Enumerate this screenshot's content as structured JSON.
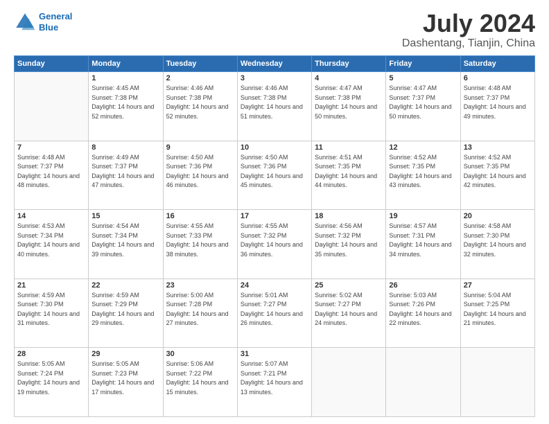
{
  "header": {
    "logo_line1": "General",
    "logo_line2": "Blue",
    "month_title": "July 2024",
    "subtitle": "Dashentang, Tianjin, China"
  },
  "calendar": {
    "days_of_week": [
      "Sunday",
      "Monday",
      "Tuesday",
      "Wednesday",
      "Thursday",
      "Friday",
      "Saturday"
    ],
    "weeks": [
      [
        {
          "day": "",
          "sunrise": "",
          "sunset": "",
          "daylight": ""
        },
        {
          "day": "1",
          "sunrise": "Sunrise: 4:45 AM",
          "sunset": "Sunset: 7:38 PM",
          "daylight": "Daylight: 14 hours and 52 minutes."
        },
        {
          "day": "2",
          "sunrise": "Sunrise: 4:46 AM",
          "sunset": "Sunset: 7:38 PM",
          "daylight": "Daylight: 14 hours and 52 minutes."
        },
        {
          "day": "3",
          "sunrise": "Sunrise: 4:46 AM",
          "sunset": "Sunset: 7:38 PM",
          "daylight": "Daylight: 14 hours and 51 minutes."
        },
        {
          "day": "4",
          "sunrise": "Sunrise: 4:47 AM",
          "sunset": "Sunset: 7:38 PM",
          "daylight": "Daylight: 14 hours and 50 minutes."
        },
        {
          "day": "5",
          "sunrise": "Sunrise: 4:47 AM",
          "sunset": "Sunset: 7:37 PM",
          "daylight": "Daylight: 14 hours and 50 minutes."
        },
        {
          "day": "6",
          "sunrise": "Sunrise: 4:48 AM",
          "sunset": "Sunset: 7:37 PM",
          "daylight": "Daylight: 14 hours and 49 minutes."
        }
      ],
      [
        {
          "day": "7",
          "sunrise": "Sunrise: 4:48 AM",
          "sunset": "Sunset: 7:37 PM",
          "daylight": "Daylight: 14 hours and 48 minutes."
        },
        {
          "day": "8",
          "sunrise": "Sunrise: 4:49 AM",
          "sunset": "Sunset: 7:37 PM",
          "daylight": "Daylight: 14 hours and 47 minutes."
        },
        {
          "day": "9",
          "sunrise": "Sunrise: 4:50 AM",
          "sunset": "Sunset: 7:36 PM",
          "daylight": "Daylight: 14 hours and 46 minutes."
        },
        {
          "day": "10",
          "sunrise": "Sunrise: 4:50 AM",
          "sunset": "Sunset: 7:36 PM",
          "daylight": "Daylight: 14 hours and 45 minutes."
        },
        {
          "day": "11",
          "sunrise": "Sunrise: 4:51 AM",
          "sunset": "Sunset: 7:35 PM",
          "daylight": "Daylight: 14 hours and 44 minutes."
        },
        {
          "day": "12",
          "sunrise": "Sunrise: 4:52 AM",
          "sunset": "Sunset: 7:35 PM",
          "daylight": "Daylight: 14 hours and 43 minutes."
        },
        {
          "day": "13",
          "sunrise": "Sunrise: 4:52 AM",
          "sunset": "Sunset: 7:35 PM",
          "daylight": "Daylight: 14 hours and 42 minutes."
        }
      ],
      [
        {
          "day": "14",
          "sunrise": "Sunrise: 4:53 AM",
          "sunset": "Sunset: 7:34 PM",
          "daylight": "Daylight: 14 hours and 40 minutes."
        },
        {
          "day": "15",
          "sunrise": "Sunrise: 4:54 AM",
          "sunset": "Sunset: 7:34 PM",
          "daylight": "Daylight: 14 hours and 39 minutes."
        },
        {
          "day": "16",
          "sunrise": "Sunrise: 4:55 AM",
          "sunset": "Sunset: 7:33 PM",
          "daylight": "Daylight: 14 hours and 38 minutes."
        },
        {
          "day": "17",
          "sunrise": "Sunrise: 4:55 AM",
          "sunset": "Sunset: 7:32 PM",
          "daylight": "Daylight: 14 hours and 36 minutes."
        },
        {
          "day": "18",
          "sunrise": "Sunrise: 4:56 AM",
          "sunset": "Sunset: 7:32 PM",
          "daylight": "Daylight: 14 hours and 35 minutes."
        },
        {
          "day": "19",
          "sunrise": "Sunrise: 4:57 AM",
          "sunset": "Sunset: 7:31 PM",
          "daylight": "Daylight: 14 hours and 34 minutes."
        },
        {
          "day": "20",
          "sunrise": "Sunrise: 4:58 AM",
          "sunset": "Sunset: 7:30 PM",
          "daylight": "Daylight: 14 hours and 32 minutes."
        }
      ],
      [
        {
          "day": "21",
          "sunrise": "Sunrise: 4:59 AM",
          "sunset": "Sunset: 7:30 PM",
          "daylight": "Daylight: 14 hours and 31 minutes."
        },
        {
          "day": "22",
          "sunrise": "Sunrise: 4:59 AM",
          "sunset": "Sunset: 7:29 PM",
          "daylight": "Daylight: 14 hours and 29 minutes."
        },
        {
          "day": "23",
          "sunrise": "Sunrise: 5:00 AM",
          "sunset": "Sunset: 7:28 PM",
          "daylight": "Daylight: 14 hours and 27 minutes."
        },
        {
          "day": "24",
          "sunrise": "Sunrise: 5:01 AM",
          "sunset": "Sunset: 7:27 PM",
          "daylight": "Daylight: 14 hours and 26 minutes."
        },
        {
          "day": "25",
          "sunrise": "Sunrise: 5:02 AM",
          "sunset": "Sunset: 7:27 PM",
          "daylight": "Daylight: 14 hours and 24 minutes."
        },
        {
          "day": "26",
          "sunrise": "Sunrise: 5:03 AM",
          "sunset": "Sunset: 7:26 PM",
          "daylight": "Daylight: 14 hours and 22 minutes."
        },
        {
          "day": "27",
          "sunrise": "Sunrise: 5:04 AM",
          "sunset": "Sunset: 7:25 PM",
          "daylight": "Daylight: 14 hours and 21 minutes."
        }
      ],
      [
        {
          "day": "28",
          "sunrise": "Sunrise: 5:05 AM",
          "sunset": "Sunset: 7:24 PM",
          "daylight": "Daylight: 14 hours and 19 minutes."
        },
        {
          "day": "29",
          "sunrise": "Sunrise: 5:05 AM",
          "sunset": "Sunset: 7:23 PM",
          "daylight": "Daylight: 14 hours and 17 minutes."
        },
        {
          "day": "30",
          "sunrise": "Sunrise: 5:06 AM",
          "sunset": "Sunset: 7:22 PM",
          "daylight": "Daylight: 14 hours and 15 minutes."
        },
        {
          "day": "31",
          "sunrise": "Sunrise: 5:07 AM",
          "sunset": "Sunset: 7:21 PM",
          "daylight": "Daylight: 14 hours and 13 minutes."
        },
        {
          "day": "",
          "sunrise": "",
          "sunset": "",
          "daylight": ""
        },
        {
          "day": "",
          "sunrise": "",
          "sunset": "",
          "daylight": ""
        },
        {
          "day": "",
          "sunrise": "",
          "sunset": "",
          "daylight": ""
        }
      ]
    ]
  }
}
